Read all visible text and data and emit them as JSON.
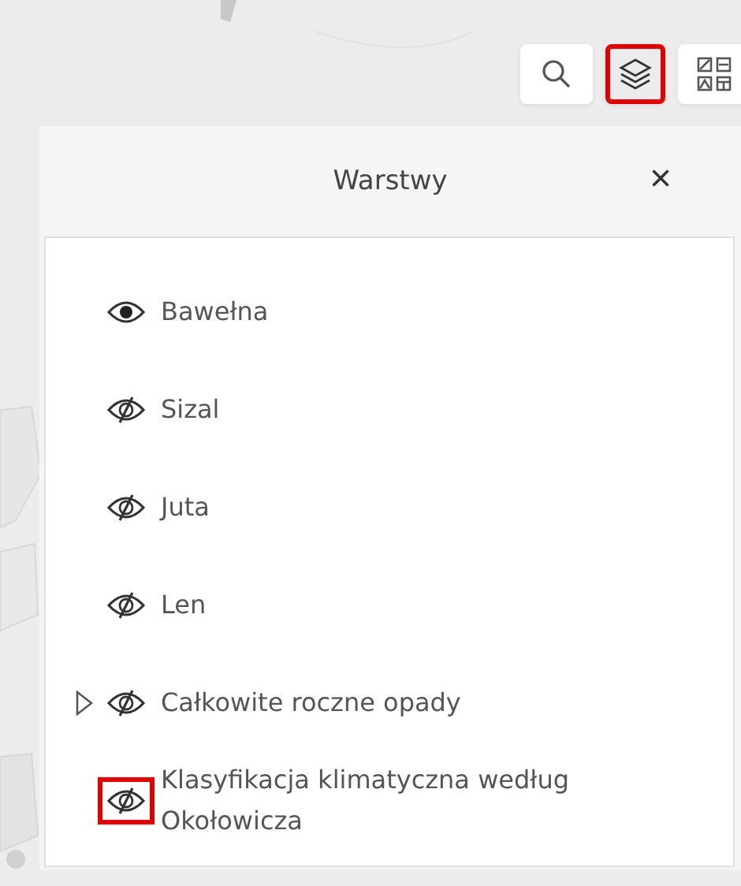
{
  "toolbar": [
    {
      "kind": "search",
      "selected": false,
      "highlighted": false
    },
    {
      "kind": "layers",
      "selected": true,
      "highlighted": true
    },
    {
      "kind": "basemap",
      "selected": false,
      "highlighted": false
    }
  ],
  "panel": {
    "title": "Warstwy",
    "close": "×"
  },
  "layers": [
    {
      "label": "Bawełna",
      "visible": true,
      "expandable": false,
      "highlighted": false
    },
    {
      "label": "Sizal",
      "visible": false,
      "expandable": false,
      "highlighted": false
    },
    {
      "label": "Juta",
      "visible": false,
      "expandable": false,
      "highlighted": false
    },
    {
      "label": "Len",
      "visible": false,
      "expandable": false,
      "highlighted": false
    },
    {
      "label": "Całkowite roczne opady",
      "visible": false,
      "expandable": true,
      "highlighted": false
    },
    {
      "label": "Klasyfikacja klimatyczna według Okołowicza",
      "visible": false,
      "expandable": false,
      "highlighted": true
    }
  ]
}
